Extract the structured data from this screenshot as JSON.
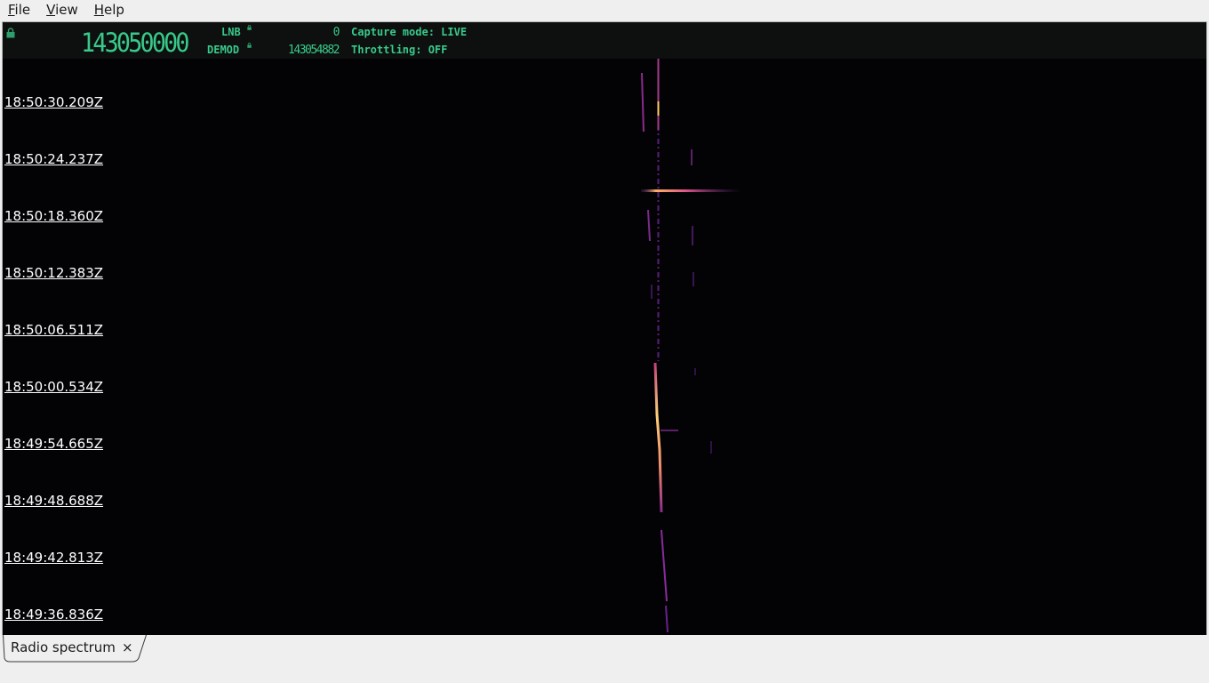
{
  "menu": [
    {
      "mnemonic": "F",
      "rest": "ile"
    },
    {
      "mnemonic": "V",
      "rest": "iew"
    },
    {
      "mnemonic": "H",
      "rest": "elp"
    }
  ],
  "status": {
    "frequency": "143050000",
    "lnb_label": "LNB",
    "lnb_value": "0",
    "demod_label": "DEMOD",
    "demod_value": "143054882",
    "capture_mode": "Capture mode: LIVE",
    "throttling": "Throttling: OFF"
  },
  "timestamps": [
    "18:50:30.209Z",
    "18:50:24.237Z",
    "18:50:18.360Z",
    "18:50:12.383Z",
    "18:50:06.511Z",
    "18:50:00.534Z",
    "18:49:54.665Z",
    "18:49:48.688Z",
    "18:49:42.813Z",
    "18:49:36.836Z"
  ],
  "tab": {
    "label": "Radio spectrum",
    "close": "×"
  },
  "colors": {
    "accent": "#39c98a",
    "background": "#030306",
    "signal_hot": "#ffd27a",
    "signal_mid": "#e0558a",
    "signal_cold": "#6a2a8a"
  }
}
